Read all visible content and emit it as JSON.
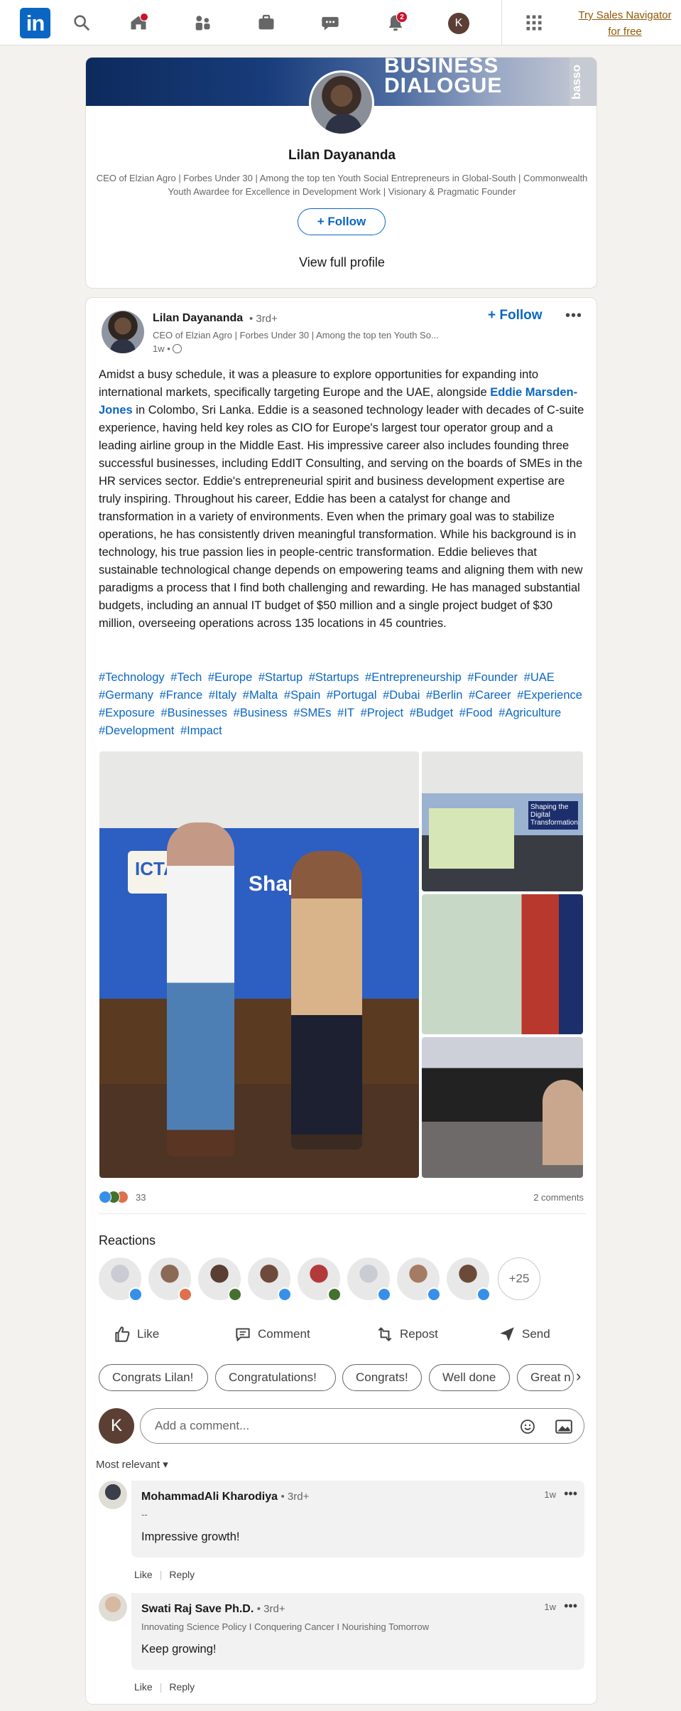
{
  "nav": {
    "logo_text": "in",
    "home_badge": "",
    "notifications_badge": "2",
    "me_initial": "K",
    "premium_cta": "Try Sales Navigator for free"
  },
  "profile_card": {
    "banner_text": "BUSINESS DIALOGUE",
    "banner_side_text": "basso",
    "name": "Lilan Dayananda",
    "headline": "CEO of Elzian Agro | Forbes Under 30 | Among the top ten Youth Social Entrepreneurs in Global-South | Commonwealth Youth Awardee for Excellence in Development Work | Visionary & Pragmatic Founder",
    "follow_label": "Follow",
    "view_profile_label": "View full profile"
  },
  "post": {
    "author_name": "Lilan Dayananda",
    "author_degree": "• 3rd+",
    "author_headline": "CEO of Elzian Agro | Forbes Under 30 | Among the top ten Youth So...",
    "time": "1w •",
    "follow_label": "Follow",
    "more_label": "•••",
    "text_before_link": "Amidst a busy schedule, it was a pleasure to explore opportunities for expanding into international markets, specifically targeting Europe and the UAE, alongside ",
    "mention": "Eddie Marsden-Jones",
    "text_after_link": " in Colombo, Sri Lanka. Eddie is a seasoned technology leader with decades of C-suite experience, having held key roles as CIO for Europe's largest tour operator group and a leading airline group in the Middle East. His impressive career also includes founding three successful businesses, including EddIT Consulting, and serving on the boards of SMEs in the HR services sector. Eddie's entrepreneurial spirit and business development expertise are truly inspiring. Throughout his career, Eddie has been a catalyst for change and transformation in a variety of environments. Even when the primary goal was to stabilize operations, he has consistently driven meaningful transformation. While his background is in technology, his true passion lies in people-centric transformation. Eddie believes that sustainable technological change depends on empowering teams and aligning them with new paradigms a process that I find both challenging and rewarding. He has managed substantial budgets, including an annual IT budget of $50 million and a single project budget of $30 million, overseeing operations across 135 locations in 45 countries.",
    "hashtags": [
      "#Technology",
      "#Tech",
      "#Europe",
      "#Startup",
      "#Startups",
      "#Entrepreneurship",
      "#Founder",
      "#UAE",
      "#Germany",
      "#France",
      "#Italy",
      "#Malta",
      "#Spain",
      "#Portugal",
      "#Dubai",
      "#Berlin",
      "#Career",
      "#Experience",
      "#Exposure",
      "#Businesses",
      "#Business",
      "#SMEs",
      "#IT",
      "#Project",
      "#Budget",
      "#Food",
      "#Agriculture",
      "#Development",
      "#Impact"
    ],
    "photo_texts": {
      "banner_org": "ICTA",
      "banner_word": "Shaping",
      "slide_title": "Shaping the Digital Transformation"
    },
    "reaction_count": "33",
    "comments_count": "2 comments",
    "reactions_title": "Reactions",
    "more_reactors": "+25",
    "actions": {
      "like": "Like",
      "comment": "Comment",
      "repost": "Repost",
      "send": "Send"
    },
    "quick_replies": [
      "Congrats Lilan!",
      "Congratulations!",
      "Congrats!",
      "Well done",
      "Great n"
    ],
    "my_initial": "K",
    "comment_placeholder": "Add a comment...",
    "sort_label": "Most relevant",
    "comments": [
      {
        "name": "MohammadAli Kharodiya",
        "degree": "• 3rd+",
        "subtitle": "--",
        "text": "Impressive growth!",
        "time": "1w",
        "like": "Like",
        "reply": "Reply"
      },
      {
        "name": "Swati Raj Save Ph.D.",
        "degree": "• 3rd+",
        "subtitle": "Innovating Science Policy I Conquering Cancer I Nourishing Tomorrow",
        "text": "Keep growing!",
        "time": "1w",
        "like": "Like",
        "reply": "Reply"
      }
    ]
  },
  "colors": {
    "brand": "#0a66c2",
    "premium": "#915907",
    "badge": "#cb112d",
    "like": "#378fe9",
    "celebrate": "#44712e",
    "love": "#df704d"
  }
}
